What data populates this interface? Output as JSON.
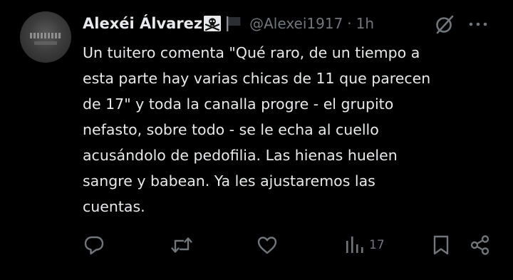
{
  "author": {
    "display_name": "Alexéi Álvarez",
    "handle": "@Alexei1917",
    "separator": "·",
    "time": "1h",
    "badges": [
      "skull-crossbones-emoji",
      "black-flag-emoji"
    ]
  },
  "tweet": {
    "lines": [
      "Un tuitero comenta \"Qué raro, de un tiempo a",
      "esta parte hay varias chicas de 11 que parecen",
      "de 17\" y toda la canalla progre - el grupito",
      "nefasto, sobre todo - se le echa al cuello",
      "acusándolo de pedofilia. Las hienas huelen",
      "sangre y babean. Ya les ajustaremos las",
      "cuentas."
    ]
  },
  "actions": {
    "reply": {
      "icon": "reply-icon"
    },
    "retweet": {
      "icon": "retweet-icon"
    },
    "like": {
      "icon": "like-icon"
    },
    "views": {
      "icon": "views-icon",
      "count": "17"
    },
    "bookmark": {
      "icon": "bookmark-icon"
    },
    "share": {
      "icon": "share-icon"
    }
  },
  "header_icons": [
    "grok-icon",
    "more-icon"
  ],
  "colors": {
    "background": "#000000",
    "text": "#e7e9ea",
    "muted": "#71767b"
  }
}
